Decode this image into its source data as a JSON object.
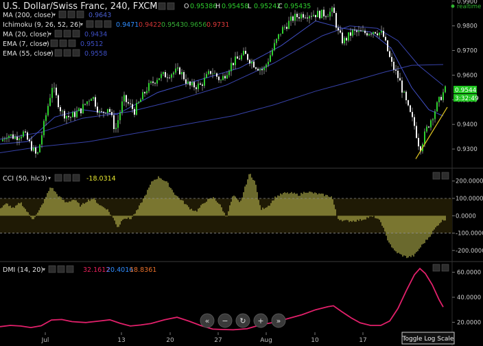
{
  "header": {
    "title": "U.S. Dollar/Swiss Franc, 240, FXCM",
    "ohlc": [
      {
        "label": "O",
        "value": "0.95386"
      },
      {
        "label": "H",
        "value": "0.95458"
      },
      {
        "label": "L",
        "value": "0.95242"
      },
      {
        "label": "C",
        "value": "0.95435"
      }
    ],
    "realtime_label": "realtime"
  },
  "studies": [
    {
      "label": "MA (200, close)",
      "values": [
        {
          "v": "0.9643",
          "color": "#4a5fd1"
        }
      ]
    },
    {
      "label": "Ichimoku (9, 26, 52, 26)",
      "values": [
        {
          "v": "0.9471",
          "color": "#2f8dff"
        },
        {
          "v": "0.9422",
          "color": "#d03535"
        },
        {
          "v": "0.9543",
          "color": "#39b239"
        },
        {
          "v": "0.9656",
          "color": "#2ea82e"
        },
        {
          "v": "0.9731",
          "color": "#e03a3a"
        }
      ]
    },
    {
      "label": "MA (20, close)",
      "values": [
        {
          "v": "0.9434",
          "color": "#3e4fc4"
        }
      ]
    },
    {
      "label": "EMA (7, close)",
      "values": [
        {
          "v": "0.9512",
          "color": "#3e4fc4"
        }
      ]
    },
    {
      "label": "EMA (55, close)",
      "values": [
        {
          "v": "0.9558",
          "color": "#3e4fc4"
        }
      ]
    }
  ],
  "price_labels": [
    {
      "text": "0.9544",
      "bg": "#1fc41f"
    },
    {
      "text": "3:32:49",
      "bg": "#1fc41f"
    }
  ],
  "cci": {
    "label": "CCI (50, hlc3)",
    "value": "-18.0314",
    "value_color": "#e8e830"
  },
  "dmi": {
    "label": "DMI (14, 20)",
    "values": [
      {
        "v": "32.1612",
        "color": "#e8205a"
      },
      {
        "v": "20.4016",
        "color": "#2f8dff"
      },
      {
        "v": "18.8361",
        "color": "#e8702a"
      }
    ]
  },
  "toolbar": {
    "toggle_log_label": "Toggle Log Scale",
    "nav_buttons": [
      {
        "name": "scroll-left-icon",
        "glyph": "«"
      },
      {
        "name": "zoom-out-icon",
        "glyph": "−"
      },
      {
        "name": "reset-chart-icon",
        "glyph": "↻"
      },
      {
        "name": "zoom-in-icon",
        "glyph": "+"
      },
      {
        "name": "scroll-right-icon",
        "glyph": "»"
      }
    ]
  },
  "chart_data": [
    {
      "type": "candlestick",
      "title": "U.S. Dollar/Swiss Franc, 240, FXCM",
      "x_ticks": [
        "Jul",
        "13",
        "20",
        "27",
        "Aug",
        "10",
        "17"
      ],
      "ylim": [
        0.9225,
        0.9905
      ],
      "y_ticks": [
        "0.9300",
        "0.9400",
        "0.9500",
        "0.9600",
        "0.9700",
        "0.9800",
        "0.9900"
      ],
      "y_tick_values": [
        0.93,
        0.94,
        0.95,
        0.96,
        0.97,
        0.98,
        0.99
      ],
      "last_price": 0.9544,
      "price_path": [
        [
          0,
          0.9325
        ],
        [
          10,
          0.936
        ],
        [
          22,
          0.9348
        ],
        [
          34,
          0.9365
        ],
        [
          46,
          0.9308
        ],
        [
          54,
          0.9268
        ],
        [
          64,
          0.9398
        ],
        [
          76,
          0.9556
        ],
        [
          90,
          0.9448
        ],
        [
          102,
          0.9428
        ],
        [
          118,
          0.946
        ],
        [
          134,
          0.952
        ],
        [
          146,
          0.9438
        ],
        [
          158,
          0.9472
        ],
        [
          168,
          0.9375
        ],
        [
          180,
          0.9505
        ],
        [
          196,
          0.9455
        ],
        [
          214,
          0.9545
        ],
        [
          230,
          0.9592
        ],
        [
          246,
          0.9605
        ],
        [
          262,
          0.9618
        ],
        [
          276,
          0.9555
        ],
        [
          292,
          0.9558
        ],
        [
          308,
          0.9618
        ],
        [
          322,
          0.9578
        ],
        [
          338,
          0.9648
        ],
        [
          356,
          0.9685
        ],
        [
          372,
          0.964
        ],
        [
          384,
          0.9618
        ],
        [
          398,
          0.9708
        ],
        [
          410,
          0.9782
        ],
        [
          428,
          0.9833
        ],
        [
          442,
          0.9848
        ],
        [
          458,
          0.9848
        ],
        [
          474,
          0.9848
        ],
        [
          486,
          0.986
        ],
        [
          492,
          0.9778
        ],
        [
          500,
          0.9735
        ],
        [
          514,
          0.9775
        ],
        [
          530,
          0.977
        ],
        [
          546,
          0.9782
        ],
        [
          558,
          0.9765
        ],
        [
          570,
          0.965
        ],
        [
          582,
          0.958
        ],
        [
          594,
          0.947
        ],
        [
          604,
          0.9395
        ],
        [
          612,
          0.93
        ],
        [
          622,
          0.9382
        ],
        [
          634,
          0.9458
        ],
        [
          644,
          0.952
        ],
        [
          650,
          0.9544
        ]
      ],
      "ma200": [
        [
          0,
          0.9285
        ],
        [
          60,
          0.931
        ],
        [
          130,
          0.933
        ],
        [
          200,
          0.9365
        ],
        [
          270,
          0.94
        ],
        [
          340,
          0.9435
        ],
        [
          400,
          0.948
        ],
        [
          460,
          0.9535
        ],
        [
          520,
          0.958
        ],
        [
          560,
          0.9612
        ],
        [
          600,
          0.964
        ],
        [
          646,
          0.9643
        ]
      ],
      "ema55": [
        [
          0,
          0.934
        ],
        [
          60,
          0.9368
        ],
        [
          120,
          0.9425
        ],
        [
          190,
          0.9452
        ],
        [
          260,
          0.95
        ],
        [
          330,
          0.956
        ],
        [
          400,
          0.965
        ],
        [
          470,
          0.976
        ],
        [
          510,
          0.98
        ],
        [
          550,
          0.979
        ],
        [
          580,
          0.974
        ],
        [
          610,
          0.964
        ],
        [
          646,
          0.9558
        ]
      ],
      "ma20": [
        [
          0,
          0.932
        ],
        [
          40,
          0.933
        ],
        [
          80,
          0.943
        ],
        [
          120,
          0.946
        ],
        [
          170,
          0.944
        ],
        [
          230,
          0.953
        ],
        [
          290,
          0.958
        ],
        [
          350,
          0.963
        ],
        [
          410,
          0.972
        ],
        [
          460,
          0.982
        ],
        [
          500,
          0.979
        ],
        [
          540,
          0.9775
        ],
        [
          570,
          0.971
        ],
        [
          600,
          0.955
        ],
        [
          625,
          0.946
        ],
        [
          646,
          0.9434
        ]
      ],
      "trendline": [
        [
          606,
          0.926
        ],
        [
          652,
          0.947
        ]
      ]
    },
    {
      "type": "bar",
      "title": "CCI (50, hlc3)",
      "ylim": [
        -260,
        270
      ],
      "y_ticks": [
        "200.0000",
        "100.0000",
        "0.0000",
        "-100.0000",
        "-200.0000"
      ],
      "y_tick_values": [
        200,
        100,
        0,
        -100,
        -200
      ],
      "reference_lines": [
        100,
        -100
      ],
      "last_value": -18.0314,
      "value_path": [
        [
          0,
          40
        ],
        [
          10,
          70
        ],
        [
          20,
          40
        ],
        [
          30,
          80
        ],
        [
          40,
          20
        ],
        [
          48,
          -20
        ],
        [
          56,
          20
        ],
        [
          66,
          100
        ],
        [
          74,
          170
        ],
        [
          84,
          120
        ],
        [
          96,
          75
        ],
        [
          108,
          95
        ],
        [
          118,
          55
        ],
        [
          126,
          85
        ],
        [
          136,
          100
        ],
        [
          146,
          60
        ],
        [
          156,
          40
        ],
        [
          166,
          -20
        ],
        [
          172,
          -70
        ],
        [
          180,
          -10
        ],
        [
          190,
          -20
        ],
        [
          200,
          30
        ],
        [
          212,
          120
        ],
        [
          222,
          200
        ],
        [
          232,
          225
        ],
        [
          244,
          190
        ],
        [
          256,
          120
        ],
        [
          266,
          85
        ],
        [
          276,
          45
        ],
        [
          286,
          25
        ],
        [
          300,
          85
        ],
        [
          312,
          105
        ],
        [
          322,
          55
        ],
        [
          330,
          -10
        ],
        [
          340,
          120
        ],
        [
          350,
          70
        ],
        [
          358,
          175
        ],
        [
          364,
          245
        ],
        [
          372,
          195
        ],
        [
          380,
          35
        ],
        [
          392,
          60
        ],
        [
          402,
          110
        ],
        [
          414,
          130
        ],
        [
          426,
          130
        ],
        [
          436,
          120
        ],
        [
          446,
          140
        ],
        [
          458,
          130
        ],
        [
          472,
          120
        ],
        [
          484,
          110
        ],
        [
          492,
          -15
        ],
        [
          502,
          -30
        ],
        [
          514,
          -30
        ],
        [
          526,
          -25
        ],
        [
          536,
          -10
        ],
        [
          546,
          -5
        ],
        [
          556,
          -40
        ],
        [
          564,
          -130
        ],
        [
          574,
          -200
        ],
        [
          584,
          -225
        ],
        [
          594,
          -240
        ],
        [
          604,
          -230
        ],
        [
          614,
          -175
        ],
        [
          624,
          -130
        ],
        [
          634,
          -75
        ],
        [
          642,
          -35
        ],
        [
          650,
          -18
        ]
      ],
      "bar_color": "#d4d25a"
    },
    {
      "type": "line",
      "title": "DMI (14, 20)",
      "ylim": [
        12,
        68
      ],
      "y_ticks": [
        "60.0000",
        "40.0000",
        "20.0000"
      ],
      "y_tick_values": [
        60,
        40,
        20
      ],
      "last_value": 32.1612,
      "series": [
        {
          "line_color": "#e3206b",
          "points": [
            [
              0,
              16.5
            ],
            [
              15,
              17.5
            ],
            [
              30,
              17.0
            ],
            [
              45,
              15.8
            ],
            [
              60,
              17.2
            ],
            [
              75,
              21.8
            ],
            [
              90,
              22.2
            ],
            [
              105,
              20.5
            ],
            [
              125,
              19.8
            ],
            [
              145,
              21.0
            ],
            [
              160,
              22.0
            ],
            [
              175,
              19.2
            ],
            [
              190,
              17.0
            ],
            [
              205,
              17.8
            ],
            [
              220,
              19.0
            ],
            [
              240,
              22.0
            ],
            [
              258,
              24.0
            ],
            [
              275,
              21.0
            ],
            [
              292,
              17.5
            ],
            [
              310,
              14.5
            ],
            [
              325,
              14.2
            ],
            [
              340,
              14.0
            ],
            [
              360,
              14.8
            ],
            [
              380,
              18.0
            ],
            [
              400,
              20.0
            ],
            [
              420,
              23.0
            ],
            [
              440,
              26.0
            ],
            [
              460,
              30.0
            ],
            [
              478,
              32.5
            ],
            [
              486,
              33.2
            ],
            [
              498,
              28.5
            ],
            [
              512,
              23.5
            ],
            [
              525,
              19.5
            ],
            [
              540,
              17.5
            ],
            [
              555,
              17.5
            ],
            [
              568,
              21.0
            ],
            [
              580,
              31.0
            ],
            [
              592,
              45.0
            ],
            [
              604,
              58.0
            ],
            [
              612,
              63.0
            ],
            [
              620,
              59.0
            ],
            [
              630,
              50.0
            ],
            [
              640,
              38.0
            ],
            [
              646,
              32.2
            ]
          ]
        }
      ]
    }
  ]
}
